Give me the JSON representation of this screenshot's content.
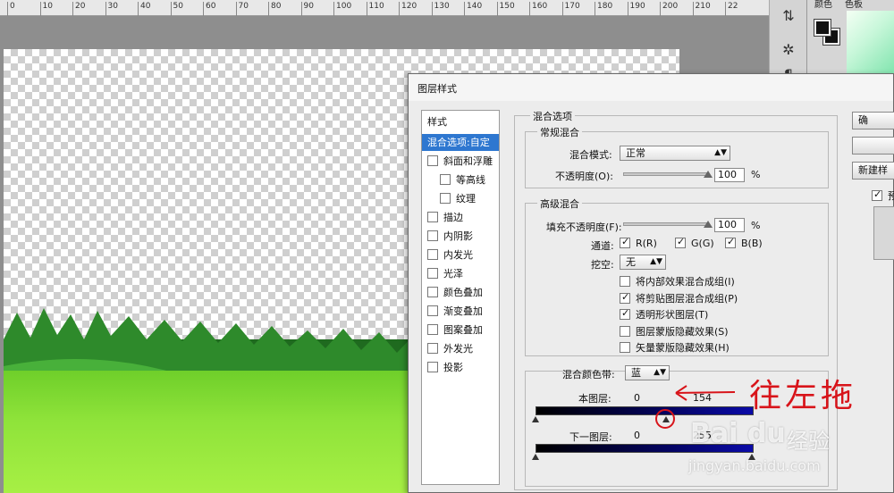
{
  "ruler": {
    "ticks": [
      "0",
      "10",
      "20",
      "30",
      "40",
      "50",
      "60",
      "70",
      "80",
      "90",
      "100",
      "110",
      "120",
      "130",
      "140",
      "150",
      "160",
      "170",
      "180",
      "190",
      "200",
      "210",
      "22"
    ]
  },
  "panels": {
    "color_tab": "颜色",
    "swatches_tab": "色板"
  },
  "dialog": {
    "title": "图层样式",
    "styles_header": "样式",
    "style_items": [
      {
        "label": "混合选项:自定",
        "checkbox": false,
        "selected": true,
        "indent": false
      },
      {
        "label": "斜面和浮雕",
        "checkbox": true,
        "checked": false,
        "indent": false
      },
      {
        "label": "等高线",
        "checkbox": true,
        "checked": false,
        "indent": true
      },
      {
        "label": "纹理",
        "checkbox": true,
        "checked": false,
        "indent": true
      },
      {
        "label": "描边",
        "checkbox": true,
        "checked": false,
        "indent": false
      },
      {
        "label": "内阴影",
        "checkbox": true,
        "checked": false,
        "indent": false
      },
      {
        "label": "内发光",
        "checkbox": true,
        "checked": false,
        "indent": false
      },
      {
        "label": "光泽",
        "checkbox": true,
        "checked": false,
        "indent": false
      },
      {
        "label": "颜色叠加",
        "checkbox": true,
        "checked": false,
        "indent": false
      },
      {
        "label": "渐变叠加",
        "checkbox": true,
        "checked": false,
        "indent": false
      },
      {
        "label": "图案叠加",
        "checkbox": true,
        "checked": false,
        "indent": false
      },
      {
        "label": "外发光",
        "checkbox": true,
        "checked": false,
        "indent": false
      },
      {
        "label": "投影",
        "checkbox": true,
        "checked": false,
        "indent": false
      }
    ],
    "blend_options": {
      "group_title": "混合选项",
      "general": {
        "title": "常规混合",
        "mode_label": "混合模式:",
        "mode_value": "正常",
        "opacity_label": "不透明度(O):",
        "opacity_value": "100",
        "opacity_unit": "%"
      },
      "advanced": {
        "title": "高级混合",
        "fill_label": "填充不透明度(F):",
        "fill_value": "100",
        "fill_unit": "%",
        "channels_label": "通道:",
        "channel_r": "R(R)",
        "channel_g": "G(G)",
        "channel_b": "B(B)",
        "knockout_label": "挖空:",
        "knockout_value": "无",
        "options": [
          {
            "label": "将内部效果混合成组(I)",
            "checked": false
          },
          {
            "label": "将剪贴图层混合成组(P)",
            "checked": true
          },
          {
            "label": "透明形状图层(T)",
            "checked": true
          },
          {
            "label": "图层蒙版隐藏效果(S)",
            "checked": false
          },
          {
            "label": "矢量蒙版隐藏效果(H)",
            "checked": false
          }
        ]
      },
      "blend_if": {
        "label": "混合颜色带:",
        "channel": "蓝",
        "this_layer_label": "本图层:",
        "this_layer_min": "0",
        "this_layer_max": "154",
        "underlying_label": "下一图层:",
        "underlying_min": "0",
        "underlying_max": "255"
      }
    },
    "buttons": {
      "ok": "确",
      "cancel": "",
      "new_style": "新建样",
      "preview": "预"
    }
  },
  "annotation": {
    "text": "往左拖"
  },
  "watermark": {
    "logo": "Bai du",
    "logo_cn": "经验",
    "url": "jingyan.baidu.com"
  },
  "colors": {
    "selection": "#2e77d0",
    "annotation": "#d8141a",
    "blend_bar": "#0a0aa8"
  }
}
